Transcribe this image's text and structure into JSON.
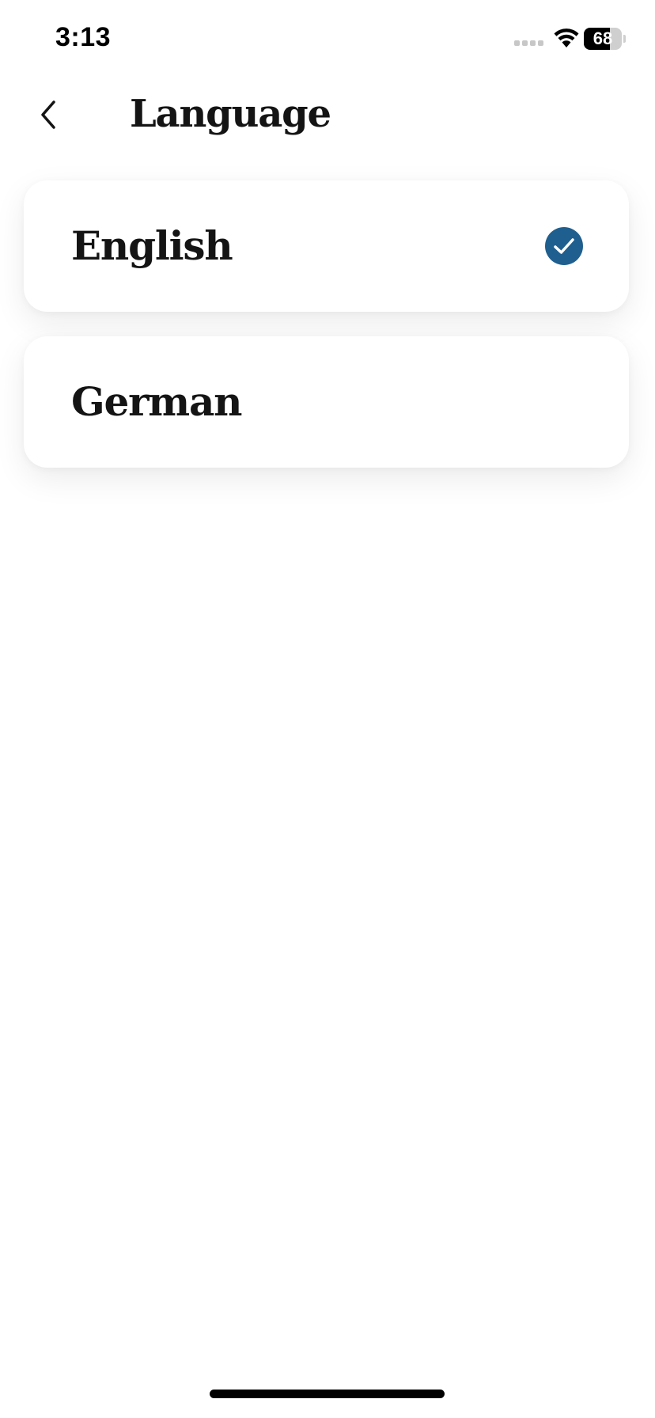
{
  "status_bar": {
    "time": "3:13",
    "battery_level": "68",
    "battery_fraction": 0.68,
    "icons": [
      "signal-icon",
      "wifi-icon",
      "battery-icon"
    ]
  },
  "header": {
    "title": "Language",
    "back_icon": "chevron-left-icon"
  },
  "languages": [
    {
      "label": "English",
      "selected": true
    },
    {
      "label": "German",
      "selected": false
    }
  ],
  "colors": {
    "accent": "#1f5f8f",
    "text": "#141414",
    "background": "#ffffff"
  }
}
